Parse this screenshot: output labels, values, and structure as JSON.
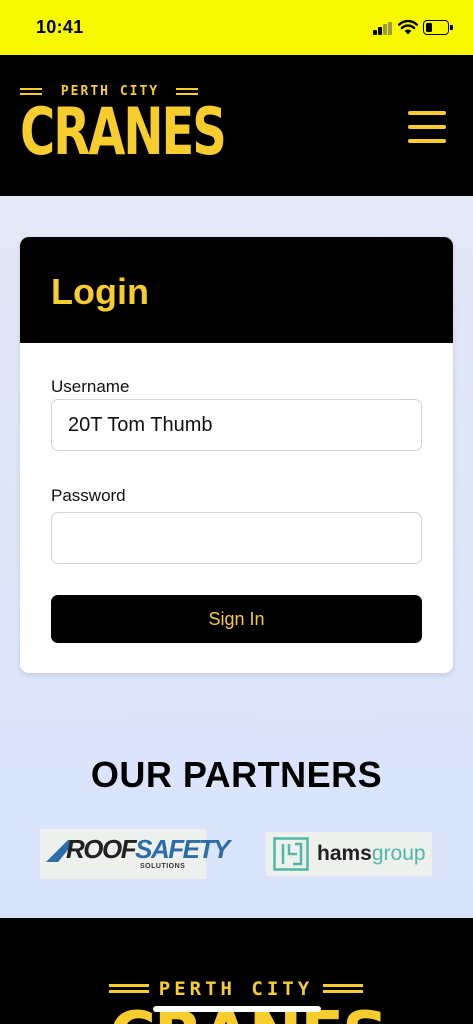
{
  "status_bar": {
    "time": "10:41"
  },
  "header": {
    "logo_top": "PERTH CITY",
    "logo_main": "CRANES"
  },
  "login": {
    "title": "Login",
    "username_label": "Username",
    "username_value": "20T Tom Thumb",
    "password_label": "Password",
    "password_value": "",
    "submit_label": "Sign In"
  },
  "partners": {
    "title": "OUR PARTNERS",
    "items": [
      {
        "name_main": "ROOF",
        "name_accent": "SAFETY",
        "sub": "SOLUTIONS"
      },
      {
        "name_main": "hams",
        "name_accent": "group"
      }
    ]
  },
  "footer": {
    "logo_top": "PERTH CITY",
    "logo_main": "CRANES"
  },
  "colors": {
    "status_bar": "#f7f700",
    "brand_yellow": "#f6cd2c",
    "header_bg": "#000000",
    "page_bg": "#e0e7f8",
    "hams_green": "#4fb9a6",
    "roof_blue": "#2b6da8"
  }
}
